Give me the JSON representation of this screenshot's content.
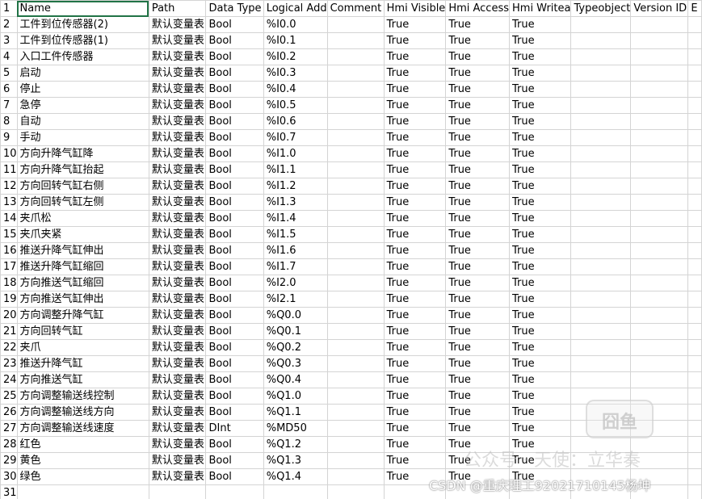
{
  "headers": [
    "Name",
    "Path",
    "Data Type",
    "Logical Add",
    "Comment",
    "Hmi Visible",
    "Hmi Access",
    "Hmi Writea",
    "Typeobject",
    "Version ID",
    "E"
  ],
  "rows": [
    [
      "工件到位传感器(2)",
      "默认变量表",
      "Bool",
      "%I0.0",
      "",
      "True",
      "True",
      "True",
      "",
      ""
    ],
    [
      "工件到位传感器(1)",
      "默认变量表",
      "Bool",
      "%I0.1",
      "",
      "True",
      "True",
      "True",
      "",
      ""
    ],
    [
      "入口工件传感器",
      "默认变量表",
      "Bool",
      "%I0.2",
      "",
      "True",
      "True",
      "True",
      "",
      ""
    ],
    [
      "启动",
      "默认变量表",
      "Bool",
      "%I0.3",
      "",
      "True",
      "True",
      "True",
      "",
      ""
    ],
    [
      "停止",
      "默认变量表",
      "Bool",
      "%I0.4",
      "",
      "True",
      "True",
      "True",
      "",
      ""
    ],
    [
      "急停",
      "默认变量表",
      "Bool",
      "%I0.5",
      "",
      "True",
      "True",
      "True",
      "",
      ""
    ],
    [
      "自动",
      "默认变量表",
      "Bool",
      "%I0.6",
      "",
      "True",
      "True",
      "True",
      "",
      ""
    ],
    [
      "手动",
      "默认变量表",
      "Bool",
      "%I0.7",
      "",
      "True",
      "True",
      "True",
      "",
      ""
    ],
    [
      "方向升降气缸降",
      "默认变量表",
      "Bool",
      "%I1.0",
      "",
      "True",
      "True",
      "True",
      "",
      ""
    ],
    [
      "方向升降气缸抬起",
      "默认变量表",
      "Bool",
      "%I1.1",
      "",
      "True",
      "True",
      "True",
      "",
      ""
    ],
    [
      "方向回转气缸右侧",
      "默认变量表",
      "Bool",
      "%I1.2",
      "",
      "True",
      "True",
      "True",
      "",
      ""
    ],
    [
      "方向回转气缸左侧",
      "默认变量表",
      "Bool",
      "%I1.3",
      "",
      "True",
      "True",
      "True",
      "",
      ""
    ],
    [
      "夹爪松",
      "默认变量表",
      "Bool",
      "%I1.4",
      "",
      "True",
      "True",
      "True",
      "",
      ""
    ],
    [
      "夹爪夹紧",
      "默认变量表",
      "Bool",
      "%I1.5",
      "",
      "True",
      "True",
      "True",
      "",
      ""
    ],
    [
      "推送升降气缸伸出",
      "默认变量表",
      "Bool",
      "%I1.6",
      "",
      "True",
      "True",
      "True",
      "",
      ""
    ],
    [
      "推送升降气缸缩回",
      "默认变量表",
      "Bool",
      "%I1.7",
      "",
      "True",
      "True",
      "True",
      "",
      ""
    ],
    [
      "方向推送气缸缩回",
      "默认变量表",
      "Bool",
      "%I2.0",
      "",
      "True",
      "True",
      "True",
      "",
      ""
    ],
    [
      "方向推送气缸伸出",
      "默认变量表",
      "Bool",
      "%I2.1",
      "",
      "True",
      "True",
      "True",
      "",
      ""
    ],
    [
      "方向调整升降气缸",
      "默认变量表",
      "Bool",
      "%Q0.0",
      "",
      "True",
      "True",
      "True",
      "",
      ""
    ],
    [
      "方向回转气缸",
      "默认变量表",
      "Bool",
      "%Q0.1",
      "",
      "True",
      "True",
      "True",
      "",
      ""
    ],
    [
      "夹爪",
      "默认变量表",
      "Bool",
      "%Q0.2",
      "",
      "True",
      "True",
      "True",
      "",
      ""
    ],
    [
      "推送升降气缸",
      "默认变量表",
      "Bool",
      "%Q0.3",
      "",
      "True",
      "True",
      "True",
      "",
      ""
    ],
    [
      "方向推送气缸",
      "默认变量表",
      "Bool",
      "%Q0.4",
      "",
      "True",
      "True",
      "True",
      "",
      ""
    ],
    [
      "方向调整输送线控制",
      "默认变量表",
      "Bool",
      "%Q1.0",
      "",
      "True",
      "True",
      "True",
      "",
      ""
    ],
    [
      "方向调整输送线方向",
      "默认变量表",
      "Bool",
      "%Q1.1",
      "",
      "True",
      "True",
      "True",
      "",
      ""
    ],
    [
      "方向调整输送线速度",
      "默认变量表",
      "DInt",
      "%MD50",
      "",
      "True",
      "True",
      "True",
      "",
      ""
    ],
    [
      "红色",
      "默认变量表",
      "Bool",
      "%Q1.2",
      "",
      "True",
      "True",
      "True",
      "",
      ""
    ],
    [
      "黄色",
      "默认变量表",
      "Bool",
      "%Q1.3",
      "",
      "True",
      "True",
      "True",
      "",
      ""
    ],
    [
      "绿色",
      "默认变量表",
      "Bool",
      "%Q1.4",
      "",
      "True",
      "True",
      "True",
      "",
      ""
    ]
  ],
  "watermark": {
    "logo_text": "囧鱼",
    "line_text": "公众号 · 天使：立华奏",
    "csdn": "CSDN @重庆理工92021710145杨坤"
  }
}
